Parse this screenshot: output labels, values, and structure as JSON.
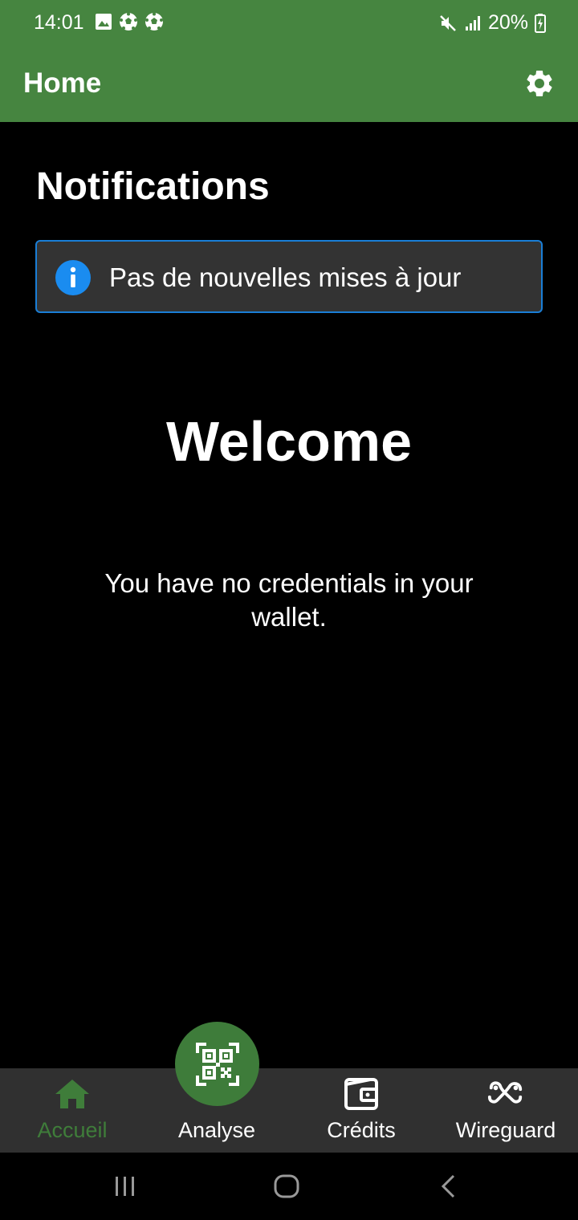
{
  "status_bar": {
    "time": "14:01",
    "battery": "20%",
    "left_icons": [
      "gallery-icon",
      "soccer-ball-icon",
      "soccer-ball-icon"
    ],
    "right_icons": [
      "mute-icon",
      "signal-icon",
      "battery-charging-icon"
    ]
  },
  "app_bar": {
    "title": "Home",
    "settings_icon": "gear-icon"
  },
  "notifications": {
    "title": "Notifications",
    "message": "Pas de nouvelles mises à jour",
    "icon": "info-icon",
    "accent": "#1a7ed6"
  },
  "main": {
    "welcome": "Welcome",
    "empty_message": "You have no credentials in your wallet."
  },
  "bottom_nav": {
    "items": [
      {
        "label": "Accueil",
        "icon": "home-icon",
        "active": true
      },
      {
        "label": "Analyse",
        "icon": "qr-code-icon",
        "active": false
      },
      {
        "label": "Crédits",
        "icon": "wallet-icon",
        "active": false
      },
      {
        "label": "Wireguard",
        "icon": "wireguard-icon",
        "active": false
      }
    ]
  },
  "colors": {
    "app_bar": "#468540",
    "active_tab": "#3f7d3a",
    "fab": "#3e7c3a",
    "background": "#000000",
    "nav_background": "#303030",
    "notice_background": "#333333"
  }
}
